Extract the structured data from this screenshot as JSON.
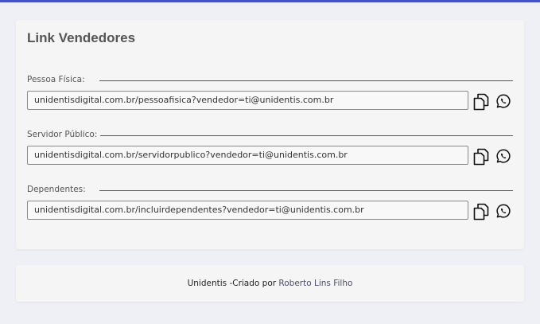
{
  "card": {
    "title": "Link Vendedores",
    "links": [
      {
        "label": "Pessoa Física:",
        "url": "unidentisdigital.com.br/pessoafisica?vendedor=ti@unidentis.com.br",
        "copy_icon": "copy-icon",
        "share_icon": "whatsapp-icon"
      },
      {
        "label": "Servidor Público:",
        "url": "unidentisdigital.com.br/servidorpublico?vendedor=ti@unidentis.com.br",
        "copy_icon": "copy-icon",
        "share_icon": "whatsapp-icon"
      },
      {
        "label": "Dependentes:",
        "url": "unidentisdigital.com.br/incluirdependentes?vendedor=ti@unidentis.com.br",
        "copy_icon": "copy-icon",
        "share_icon": "whatsapp-icon"
      }
    ]
  },
  "footer": {
    "text": "Unidentis -Criado por ",
    "author": "Roberto Lins Filho"
  },
  "colors": {
    "accent_bar": "#4353c4",
    "page_background": "#eef0f6",
    "card_background": "#f5f5f5",
    "text": "#555555"
  }
}
